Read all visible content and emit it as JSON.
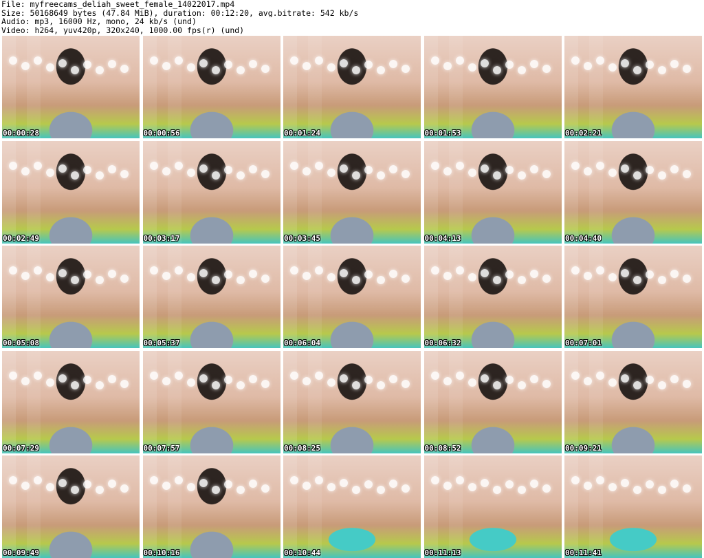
{
  "header": {
    "lines": [
      "File: myfreecams_deliah_sweet_female_14022017.mp4",
      "Size: 50168649 bytes (47.84 MiB), duration: 00:12:20, avg.bitrate: 542 kb/s",
      "Audio: mp3, 16000 Hz, mono, 24 kb/s (und)",
      "Video: h264, yuv420p, 320x240, 1000.00 fps(r) (und)"
    ]
  },
  "thumbnails": [
    {
      "timestamp": "00:00:28",
      "scene": "person"
    },
    {
      "timestamp": "00:00:56",
      "scene": "person"
    },
    {
      "timestamp": "00:01:24",
      "scene": "person"
    },
    {
      "timestamp": "00:01:53",
      "scene": "person"
    },
    {
      "timestamp": "00:02:21",
      "scene": "person"
    },
    {
      "timestamp": "00:02:49",
      "scene": "person"
    },
    {
      "timestamp": "00:03:17",
      "scene": "person"
    },
    {
      "timestamp": "00:03:45",
      "scene": "person"
    },
    {
      "timestamp": "00:04:13",
      "scene": "person"
    },
    {
      "timestamp": "00:04:40",
      "scene": "person"
    },
    {
      "timestamp": "00:05:08",
      "scene": "person"
    },
    {
      "timestamp": "00:05:37",
      "scene": "person"
    },
    {
      "timestamp": "00:06:04",
      "scene": "person"
    },
    {
      "timestamp": "00:06:32",
      "scene": "person"
    },
    {
      "timestamp": "00:07:01",
      "scene": "person"
    },
    {
      "timestamp": "00:07:29",
      "scene": "person"
    },
    {
      "timestamp": "00:07:57",
      "scene": "person"
    },
    {
      "timestamp": "00:08:25",
      "scene": "person"
    },
    {
      "timestamp": "00:08:52",
      "scene": "person"
    },
    {
      "timestamp": "00:09:21",
      "scene": "person"
    },
    {
      "timestamp": "00:09:49",
      "scene": "person"
    },
    {
      "timestamp": "00:10:16",
      "scene": "person"
    },
    {
      "timestamp": "00:10:44",
      "scene": "empty"
    },
    {
      "timestamp": "00:11:13",
      "scene": "empty"
    },
    {
      "timestamp": "00:11:41",
      "scene": "empty"
    }
  ]
}
